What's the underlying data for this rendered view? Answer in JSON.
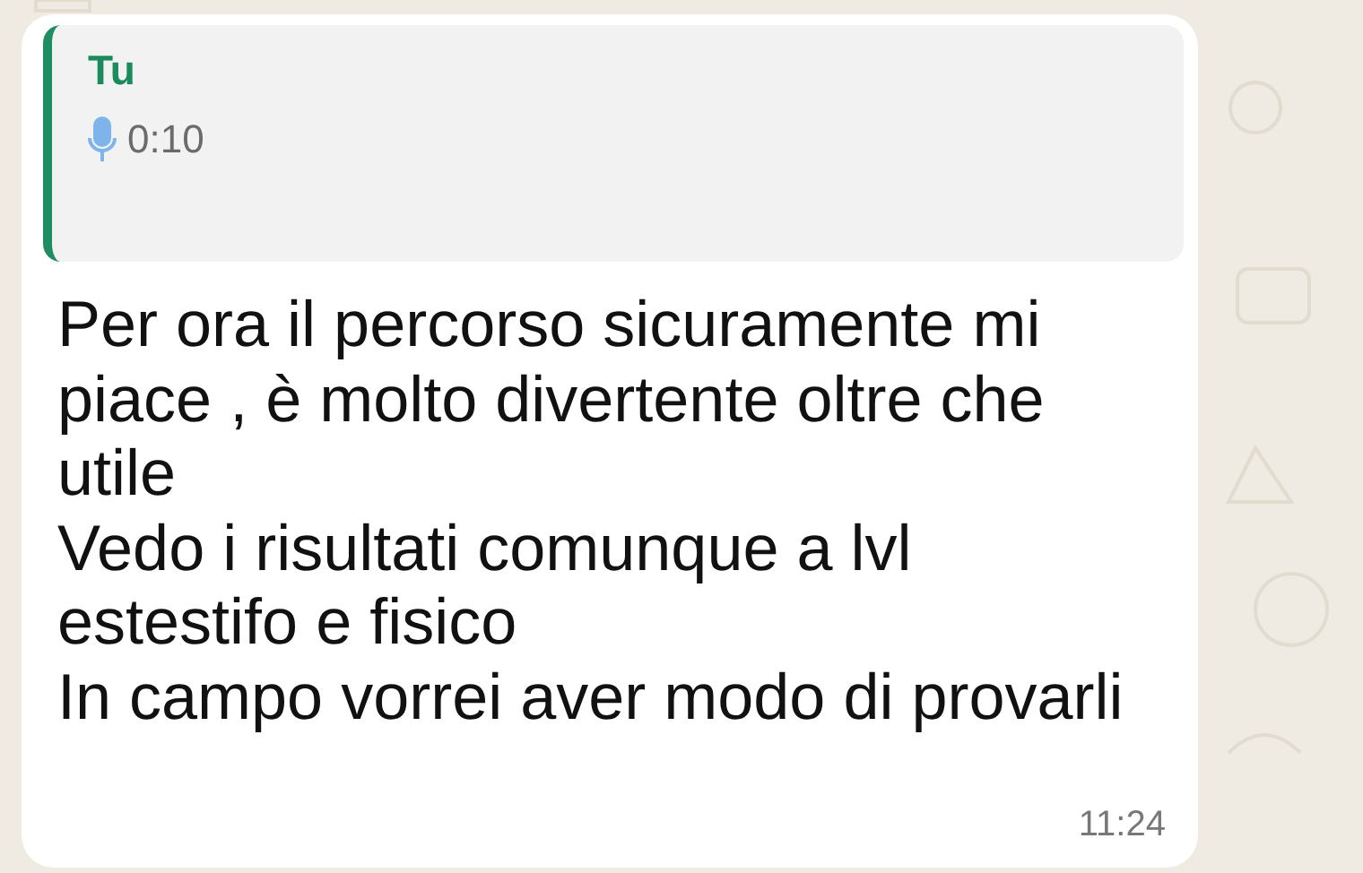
{
  "message": {
    "quoted": {
      "author": "Tu",
      "kind": "voice",
      "duration": "0:10"
    },
    "text": "Per ora il percorso sicuramente mi piace , è molto divertente oltre che utile\nVedo i risultati comunque a lvl estestifo e fisico\nIn campo vorrei aver modo di provarli",
    "time": "11:24"
  }
}
